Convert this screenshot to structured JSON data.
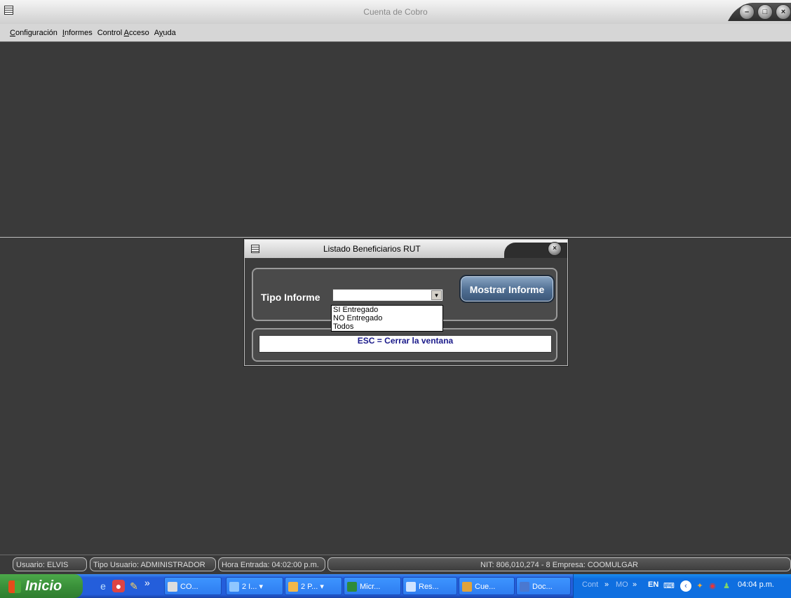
{
  "window": {
    "title": "Cuenta de Cobro"
  },
  "menu": [
    {
      "underlined": "C",
      "rest": "onfiguración"
    },
    {
      "underlined": "I",
      "rest": "nformes"
    },
    {
      "prefix": "Control ",
      "underlined": "A",
      "rest": "cceso"
    },
    {
      "prefix": "A",
      "underlined": "y",
      "rest": "uda"
    }
  ],
  "dialog": {
    "title": "Listado Beneficiarios RUT",
    "tipo_label": "Tipo Informe",
    "combo_value": "",
    "options": [
      "SI Entregado",
      "NO Entregado",
      "Todos"
    ],
    "show_button": "Mostrar Informe",
    "esc_text": "ESC = Cerrar la ventana"
  },
  "status": {
    "usuario": "Usuario: ELVIS",
    "tipo_usuario": "Tipo Usuario: ADMINISTRADOR",
    "hora": "Hora Entrada: 04:02:00 p.m.",
    "empresa": "NIT: 806,010,274 - 8  Empresa: COOMULGAR"
  },
  "taskbar": {
    "start": "Inicio",
    "buttons": [
      "CO...",
      "2 I...",
      "2 P...",
      "Micr...",
      "Res...",
      "Cue...",
      "Doc..."
    ],
    "tray": {
      "cont": "Cont",
      "mo": "MO",
      "lang": "EN",
      "clock": "04:04 p.m."
    }
  }
}
